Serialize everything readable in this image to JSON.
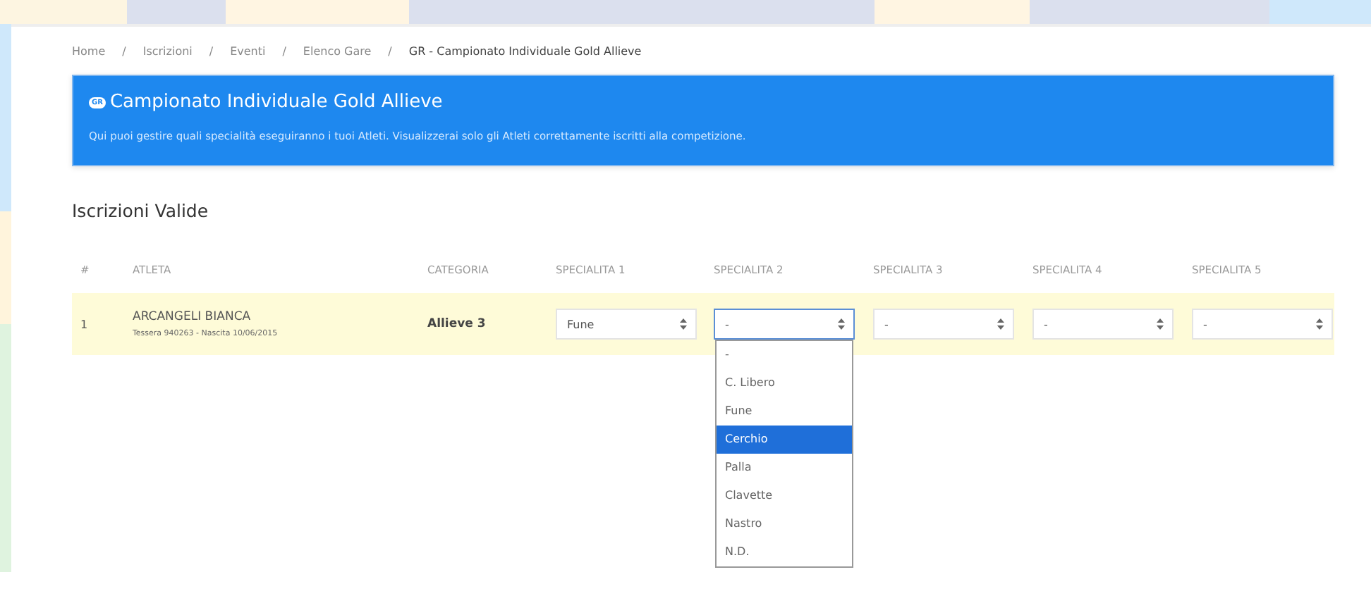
{
  "breadcrumb": [
    {
      "label": "Home",
      "current": false
    },
    {
      "separator": "/",
      "label": "Iscrizioni",
      "current": false
    },
    {
      "separator": "/",
      "label": "Eventi",
      "current": false
    },
    {
      "separator": "/",
      "label": "Elenco Gare",
      "current": false
    },
    {
      "separator": "/",
      "label": "GR - Campionato Individuale Gold Allieve",
      "current": true
    }
  ],
  "banner": {
    "badge": "GR",
    "title": "Campionato Individuale Gold Allieve",
    "description": "Qui puoi gestire quali specialità eseguiranno i tuoi Atleti. Visualizzerai solo gli Atleti correttamente iscritti alla competizione."
  },
  "section_title": "Iscrizioni Valide",
  "table": {
    "columns": [
      "#",
      "ATLETA",
      "CATEGORIA",
      "SPECIALITA 1",
      "SPECIALITA 2",
      "SPECIALITA 3",
      "SPECIALITA 4",
      "SPECIALITA 5"
    ],
    "rows": [
      {
        "number": "1",
        "athlete": "ARCANGELI BIANCA",
        "details": "Tessera 940263 - Nascita 10/06/2015",
        "category": "Allieve 3",
        "specialties": [
          {
            "value": "Fune",
            "open": false
          },
          {
            "value": "-",
            "open": true
          },
          {
            "value": "-",
            "open": false
          },
          {
            "value": "-",
            "open": false
          },
          {
            "value": "-",
            "open": false
          }
        ]
      }
    ]
  },
  "dropdown": {
    "options": [
      {
        "label": "-",
        "selected": false
      },
      {
        "label": "C. Libero",
        "selected": false
      },
      {
        "label": "Fune",
        "selected": false
      },
      {
        "label": "Cerchio",
        "selected": true
      },
      {
        "label": "Palla",
        "selected": false
      },
      {
        "label": "Clavette",
        "selected": false
      },
      {
        "label": "Nastro",
        "selected": false
      },
      {
        "label": "N.D.",
        "selected": false
      }
    ]
  }
}
